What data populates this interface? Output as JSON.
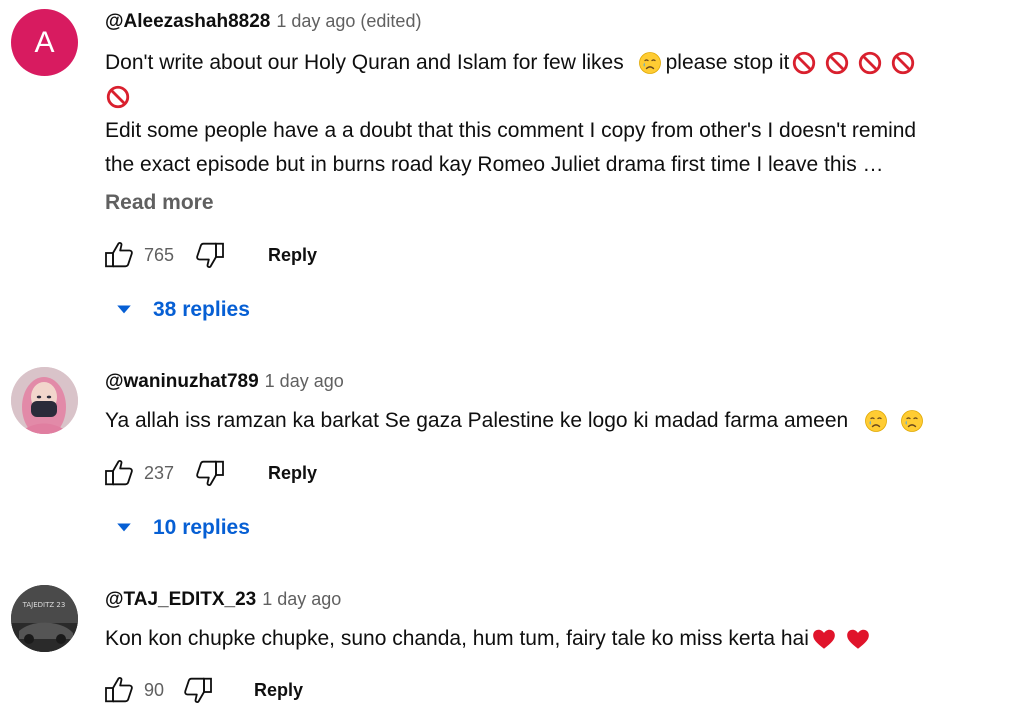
{
  "comments": [
    {
      "avatar_letter": "A",
      "avatar_color": "#d81b60",
      "author": "@Aleezashah8828",
      "timestamp": "1 day ago (edited)",
      "text_1": "Don't write about our Holy Quran and Islam for few likes",
      "text_2": "please stop it",
      "text_3": "Edit some people have a a doubt that this comment I copy from other's I doesn't remind",
      "text_4": "the exact episode but in  burns road kay Romeo Juliet drama first time I leave this …",
      "read_more": "Read more",
      "likes": "765",
      "reply_label": "Reply",
      "replies_label": "38 replies"
    },
    {
      "author": "@waninuzhat789",
      "timestamp": "1 day ago",
      "text_1": "Ya allah iss ramzan ka barkat Se gaza Palestine ke logo ki madad farma ameen",
      "likes": "237",
      "reply_label": "Reply",
      "replies_label": "10 replies"
    },
    {
      "author": "@TAJ_EDITX_23",
      "timestamp": "1 day ago",
      "text_1": "Kon kon chupke chupke, suno chanda, hum tum, fairy tale ko miss kerta hai",
      "likes": "90",
      "reply_label": "Reply",
      "avatar_text": "TAJEDITZ 23"
    }
  ],
  "icons": {
    "like": "thumbs-up-icon",
    "dislike": "thumbs-down-icon",
    "expand": "caret-down-icon",
    "sad_emoji": "crying-face-emoji",
    "prohibited_emoji": "prohibited-emoji",
    "heart_emoji": "red-heart-emoji"
  },
  "colors": {
    "link_blue": "#065fd4",
    "secondary_text": "#606060",
    "heart_red": "#e0142b",
    "prohibited_red": "#d9202e"
  }
}
